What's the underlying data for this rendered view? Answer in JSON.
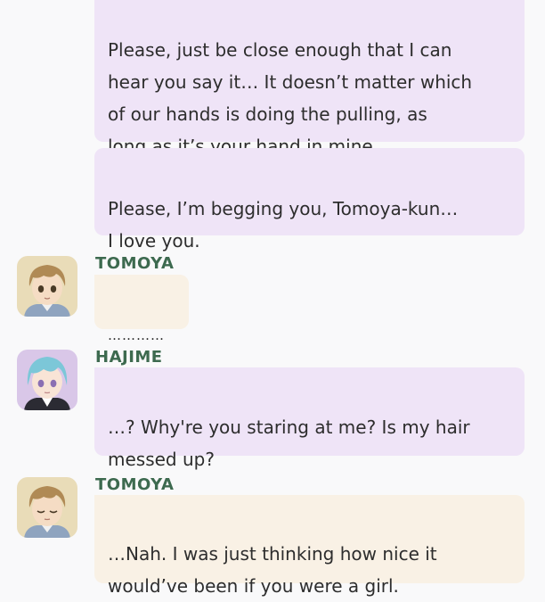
{
  "messages": [
    {
      "text": "Please, just be close enough that I can\nhear you say it… It doesn’t matter which\nof our hands is doing the pulling, as\nlong as it’s your hand in mine."
    },
    {
      "text": "Please, I’m begging you, Tomoya-kun…\nI love you."
    },
    {
      "speaker": "TOMOYA",
      "avatar_icon": "tomoya-avatar-icon",
      "text": "…………"
    },
    {
      "speaker": "HAJIME",
      "avatar_icon": "hajime-avatar-icon",
      "text": "…? Why're you staring at me? Is my hair\nmessed up?"
    },
    {
      "speaker": "TOMOYA",
      "avatar_icon": "tomoya-avatar-icon",
      "text": "…Nah. I was just thinking how nice it\nwould’ve been if you were a girl."
    }
  ],
  "colors": {
    "background": "#f9f9fa",
    "hajime_bubble": "#efe4f7",
    "tomoya_bubble": "#f9f1e5",
    "speaker_name": "#3d6a4f"
  }
}
